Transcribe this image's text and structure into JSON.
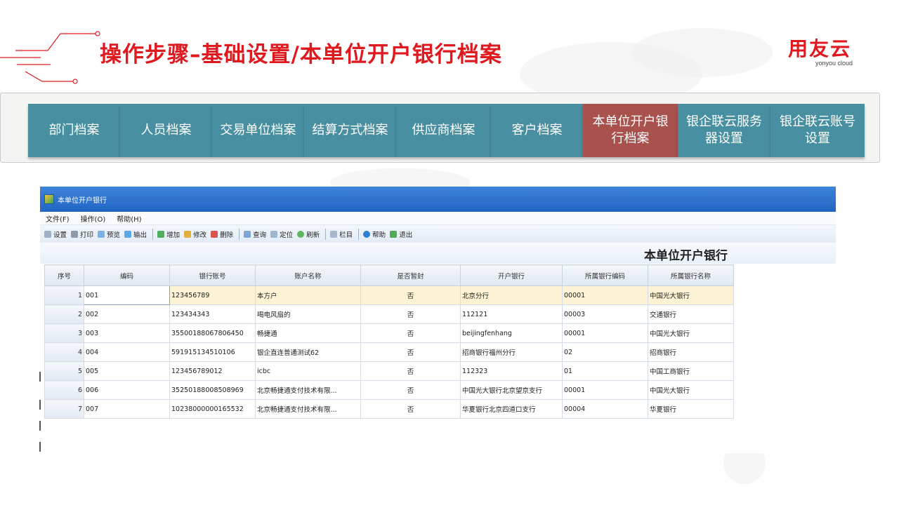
{
  "title": "操作步骤–基础设置/本单位开户银行档案",
  "logo": {
    "cn": "用友云",
    "en": "yonyou cloud"
  },
  "colors": {
    "accent_red": "#e0191f",
    "tab_teal": "#478fa1",
    "tab_active": "#a9524d"
  },
  "tabs": [
    {
      "label": "部门档案",
      "active": false
    },
    {
      "label": "人员档案",
      "active": false
    },
    {
      "label": "交易单位档案",
      "active": false
    },
    {
      "label": "结算方式档案",
      "active": false
    },
    {
      "label": "供应商档案",
      "active": false
    },
    {
      "label": "客户档案",
      "active": false
    },
    {
      "label": "本单位开户银行档案",
      "active": true
    },
    {
      "label": "银企联云服务器设置",
      "active": false
    },
    {
      "label": "银企联云账号设置",
      "active": false
    }
  ],
  "app": {
    "window_title": "本单位开户银行",
    "menu": [
      "文件(F)",
      "操作(O)",
      "帮助(H)"
    ],
    "toolbar": [
      {
        "label": "设置",
        "icon": "settings-icon"
      },
      {
        "label": "打印",
        "icon": "print-icon"
      },
      {
        "label": "预览",
        "icon": "preview-icon"
      },
      {
        "label": "输出",
        "icon": "export-icon"
      },
      {
        "label": "增加",
        "icon": "add-icon"
      },
      {
        "label": "修改",
        "icon": "edit-icon"
      },
      {
        "label": "删除",
        "icon": "delete-icon"
      },
      {
        "label": "查询",
        "icon": "search-icon"
      },
      {
        "label": "定位",
        "icon": "locate-icon"
      },
      {
        "label": "刷新",
        "icon": "refresh-icon"
      },
      {
        "label": "栏目",
        "icon": "columns-icon"
      },
      {
        "label": "帮助",
        "icon": "help-icon"
      },
      {
        "label": "退出",
        "icon": "exit-icon"
      }
    ],
    "content_title": "本单位开户银行",
    "columns": [
      "序号",
      "编码",
      "银行账号",
      "账户名称",
      "是否暂封",
      "开户银行",
      "所属银行编码",
      "所属银行名称"
    ],
    "rows": [
      [
        "1",
        "001",
        "123456789",
        "本方户",
        "否",
        "北京分行",
        "00001",
        "中国光大银行"
      ],
      [
        "2",
        "002",
        "123434343",
        "喝电风扇的",
        "否",
        "112121",
        "00003",
        "交通银行"
      ],
      [
        "3",
        "003",
        "35500188067806450",
        "畅捷通",
        "否",
        "beijingfenhang",
        "00001",
        "中国光大银行"
      ],
      [
        "4",
        "004",
        "591915134510106",
        "银企直连普通测试62",
        "否",
        "招商银行福州分行",
        "02",
        "招商银行"
      ],
      [
        "5",
        "005",
        "123456789012",
        "icbc",
        "否",
        "112323",
        "01",
        "中国工商银行"
      ],
      [
        "6",
        "006",
        "35250188008508969",
        "北京畅捷通支付技术有限...",
        "否",
        "中国光大银行北京望京支行",
        "00001",
        "中国光大银行"
      ],
      [
        "7",
        "007",
        "10238000000165532",
        "北京畅捷通支付技术有限...",
        "否",
        "华夏银行北京四道口支行",
        "00004",
        "华夏银行"
      ]
    ],
    "selected_row": 1
  }
}
